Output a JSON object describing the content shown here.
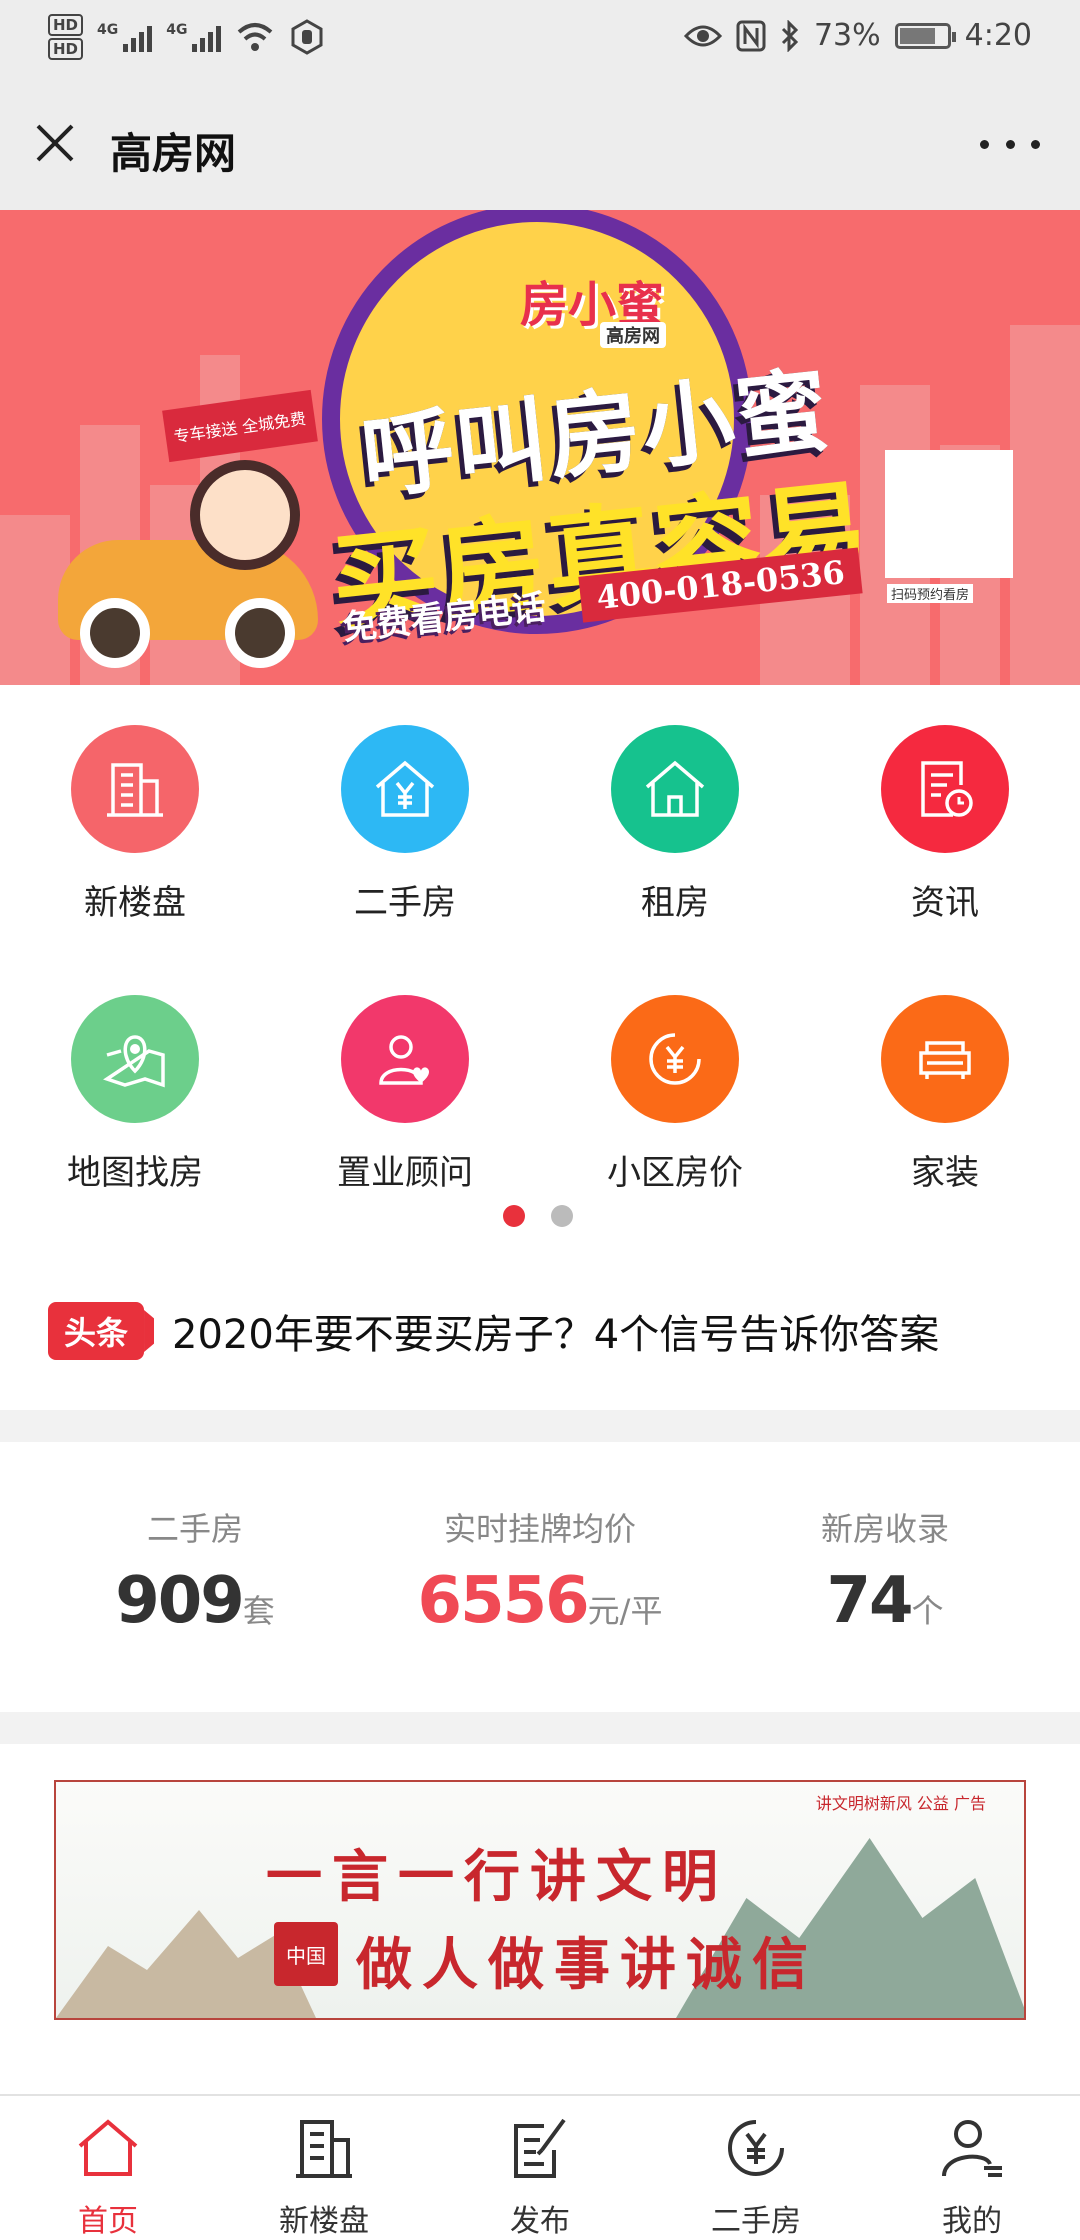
{
  "status_bar": {
    "hd1": "HD",
    "hd2": "HD",
    "net1": "4G",
    "net2": "4G",
    "battery": "73%",
    "time": "4:20"
  },
  "title_bar": {
    "title": "高房网"
  },
  "banner": {
    "logo": "房小蜜",
    "logo_sub": "高房网",
    "flag_text": "专车接送 全城免费",
    "slogan_line1": "呼叫房小蜜",
    "slogan_line2": "买房真容易",
    "tel_label": "免费看房电话",
    "tel_number": "400-018-0536",
    "qr_caption": "扫码预约看房"
  },
  "menu": {
    "items": [
      {
        "label": "新楼盘",
        "icon": "building-icon",
        "color": "#f5656a"
      },
      {
        "label": "二手房",
        "icon": "yuan-house-icon",
        "color": "#2db8f4"
      },
      {
        "label": "租房",
        "icon": "house-icon",
        "color": "#16c28e"
      },
      {
        "label": "资讯",
        "icon": "news-clock-icon",
        "color": "#f5293f"
      },
      {
        "label": "地图找房",
        "icon": "map-pin-icon",
        "color": "#6ccf8b"
      },
      {
        "label": "置业顾问",
        "icon": "consultant-icon",
        "color": "#f2386b"
      },
      {
        "label": "小区房价",
        "icon": "yuan-circle-icon",
        "color": "#fb6a17"
      },
      {
        "label": "家装",
        "icon": "sofa-icon",
        "color": "#fb6a17"
      }
    ]
  },
  "headline": {
    "tag": "头条",
    "text": "2020年要不要买房子？4个信号告诉你答案"
  },
  "stats": [
    {
      "label": "二手房",
      "value": "909",
      "unit": "套",
      "color": "#333333"
    },
    {
      "label": "实时挂牌均价",
      "value": "6556",
      "unit": "元/平",
      "color": "#f04a55"
    },
    {
      "label": "新房收录",
      "value": "74",
      "unit": "个",
      "color": "#333333"
    }
  ],
  "ad": {
    "corner": "讲文明树新风 公益 广告",
    "seal": "中国",
    "line1": "一言一行讲文明",
    "line2": "做人做事讲诚信"
  },
  "tab_bar": {
    "tabs": [
      {
        "label": "首页",
        "icon": "home-icon",
        "active": true
      },
      {
        "label": "新楼盘",
        "icon": "building-icon",
        "active": false
      },
      {
        "label": "发布",
        "icon": "edit-icon",
        "active": false
      },
      {
        "label": "二手房",
        "icon": "yuan-circle-icon",
        "active": false
      },
      {
        "label": "我的",
        "icon": "user-icon",
        "active": false
      }
    ]
  },
  "colors": {
    "accent": "#e8313c",
    "banner_bg": "#f76b6d",
    "dot_active": "#e8313c",
    "dot_inactive": "#bbbbbb"
  }
}
